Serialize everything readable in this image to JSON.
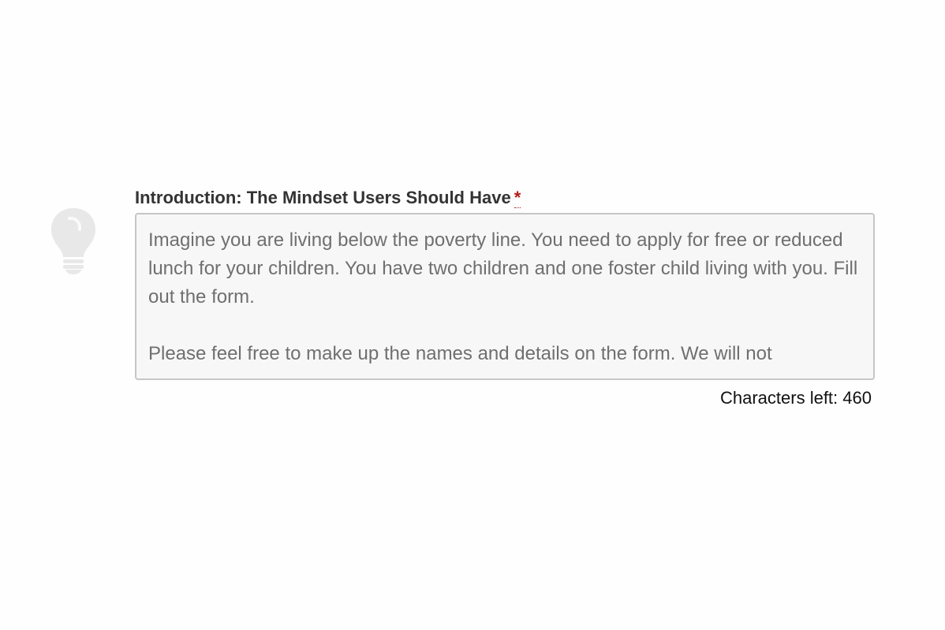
{
  "field": {
    "label": "Introduction: The Mindset Users Should Have",
    "required_marker": "*",
    "value": "Imagine you are living below the poverty line. You need to apply for free or reduced lunch for your children. You have two children and one foster child living with you. Fill out the form.\n\nPlease feel free to make up the names and details on the form. We will not",
    "counter_label": "Characters left:",
    "counter_value": "460"
  },
  "icons": {
    "hint": "lightbulb-icon"
  },
  "colors": {
    "label": "#333333",
    "required": "#b31b1b",
    "textarea_bg": "#f7f7f7",
    "textarea_border": "#c6c6c6",
    "textarea_text": "#6f6f6f",
    "icon": "#e6e6e6"
  }
}
